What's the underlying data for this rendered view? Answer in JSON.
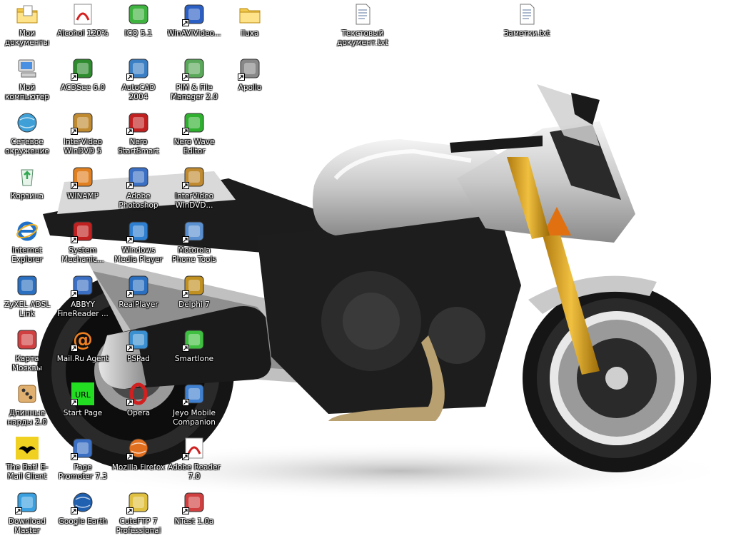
{
  "desktop": {
    "wallpaper": "yamaha-fz1-motorcycle",
    "icons": [
      {
        "label": "Мои документы",
        "icon": "my-documents-icon",
        "color": "#f2c94c",
        "shortcut": false
      },
      {
        "label": "Alcohol 120%",
        "icon": "alcohol-120-icon",
        "color": "#d62020",
        "shortcut": false
      },
      {
        "label": "ICQ 5.1",
        "icon": "icq-icon",
        "color": "#3fb33f",
        "shortcut": false
      },
      {
        "label": "WinAVIVideo...",
        "icon": "winavi-video-icon",
        "color": "#2b5fc4",
        "shortcut": true
      },
      {
        "label": "iluxa",
        "icon": "folder-icon",
        "color": "#f2c94c",
        "shortcut": false
      },
      {
        "label": "Текстовый документ.txt",
        "icon": "text-document-icon",
        "color": "#ffffff",
        "shortcut": false
      },
      {
        "label": "Заметки.txt",
        "icon": "notes-text-icon",
        "color": "#ffffff",
        "shortcut": false
      },
      {
        "label": "Мой компьютер",
        "icon": "my-computer-icon",
        "color": "#4a90e2",
        "shortcut": false
      },
      {
        "label": "ACDSee 6.0",
        "icon": "acdsee-icon",
        "color": "#2e8b2e",
        "shortcut": true
      },
      {
        "label": "AutoCAD 2004",
        "icon": "autocad-icon",
        "color": "#3a7fc4",
        "shortcut": true
      },
      {
        "label": "PIM & File Manager 2.0",
        "icon": "pim-file-manager-icon",
        "color": "#5aa85a",
        "shortcut": true
      },
      {
        "label": "Apollo",
        "icon": "apollo-icon",
        "color": "#888888",
        "shortcut": true
      },
      {
        "label": "Сетевое окружение",
        "icon": "network-places-icon",
        "color": "#3fa0d8",
        "shortcut": false
      },
      {
        "label": "InterVideo WinDVD 5",
        "icon": "windvd-icon",
        "color": "#c08a30",
        "shortcut": true
      },
      {
        "label": "Nero StartSmart",
        "icon": "nero-icon",
        "color": "#c02020",
        "shortcut": true
      },
      {
        "label": "Nero Wave Editor",
        "icon": "nero-wave-icon",
        "color": "#2fb02f",
        "shortcut": true
      },
      {
        "label": "Корзина",
        "icon": "recycle-bin-icon",
        "color": "#2fa84f",
        "shortcut": false
      },
      {
        "label": "WINAMP",
        "icon": "winamp-icon",
        "color": "#e08020",
        "shortcut": true
      },
      {
        "label": "Adobe Photoshop CS2",
        "icon": "photoshop-icon",
        "color": "#3a6fc4",
        "shortcut": true
      },
      {
        "label": "InterVideo WinDVD...",
        "icon": "windvd-icon",
        "color": "#c08a30",
        "shortcut": true
      },
      {
        "label": "Internet Explorer",
        "icon": "internet-explorer-icon",
        "color": "#1e70c8",
        "shortcut": false
      },
      {
        "label": "System Mechanic...",
        "icon": "system-mechanic-icon",
        "color": "#c02020",
        "shortcut": true
      },
      {
        "label": "Windows Media Player",
        "icon": "media-player-icon",
        "color": "#2f7fd0",
        "shortcut": true
      },
      {
        "label": "Motorola Phone Tools",
        "icon": "motorola-icon",
        "color": "#5a8fd0",
        "shortcut": true
      },
      {
        "label": "ZyXEL ADSL Link",
        "icon": "zyxel-icon",
        "color": "#2a6fc0",
        "shortcut": false
      },
      {
        "label": "ABBYY FineReader ...",
        "icon": "finereader-icon",
        "color": "#3a6fc4",
        "shortcut": true
      },
      {
        "label": "RealPlayer",
        "icon": "realplayer-icon",
        "color": "#2a6fc0",
        "shortcut": true
      },
      {
        "label": "Delphi 7",
        "icon": "delphi-icon",
        "color": "#c09020",
        "shortcut": true
      },
      {
        "label": "Карта Москвы",
        "icon": "moscow-map-icon",
        "color": "#d04040",
        "shortcut": false
      },
      {
        "label": "Mail.Ru Agent",
        "icon": "mailru-agent-icon",
        "color": "#f08020",
        "shortcut": true
      },
      {
        "label": "PSPad",
        "icon": "pspad-icon",
        "color": "#3a8fd0",
        "shortcut": true
      },
      {
        "label": "Smartlone",
        "icon": "smartlone-icon",
        "color": "#40c040",
        "shortcut": true
      },
      {
        "label": "Длинные нарды 2.0",
        "icon": "backgammon-icon",
        "color": "#e0b070",
        "shortcut": false
      },
      {
        "label": "Start Page",
        "icon": "start-page-icon",
        "color": "#22dd22",
        "shortcut": true
      },
      {
        "label": "Opera",
        "icon": "opera-icon",
        "color": "#d02020",
        "shortcut": true
      },
      {
        "label": "Jeyo Mobile Companion 1.1",
        "icon": "jeyo-icon",
        "color": "#4080d0",
        "shortcut": true
      },
      {
        "label": "The Bat! E-Mail Client",
        "icon": "the-bat-icon",
        "color": "#f0d020",
        "shortcut": false
      },
      {
        "label": "Page Promoter 7.3",
        "icon": "page-promoter-icon",
        "color": "#3a6fc4",
        "shortcut": true
      },
      {
        "label": "Mozilla Firefox",
        "icon": "firefox-icon",
        "color": "#e07020",
        "shortcut": true
      },
      {
        "label": "Adobe Reader 7.0",
        "icon": "adobe-reader-icon",
        "color": "#d02020",
        "shortcut": true
      },
      {
        "label": "Download Master",
        "icon": "download-master-icon",
        "color": "#3aa0e0",
        "shortcut": true
      },
      {
        "label": "Google Earth",
        "icon": "google-earth-icon",
        "color": "#2060b0",
        "shortcut": true
      },
      {
        "label": "CuteFTP 7 Professional",
        "icon": "cuteftp-icon",
        "color": "#e0c040",
        "shortcut": true
      },
      {
        "label": "NTest 1.0a",
        "icon": "ntest-icon",
        "color": "#d04040",
        "shortcut": true
      }
    ]
  }
}
